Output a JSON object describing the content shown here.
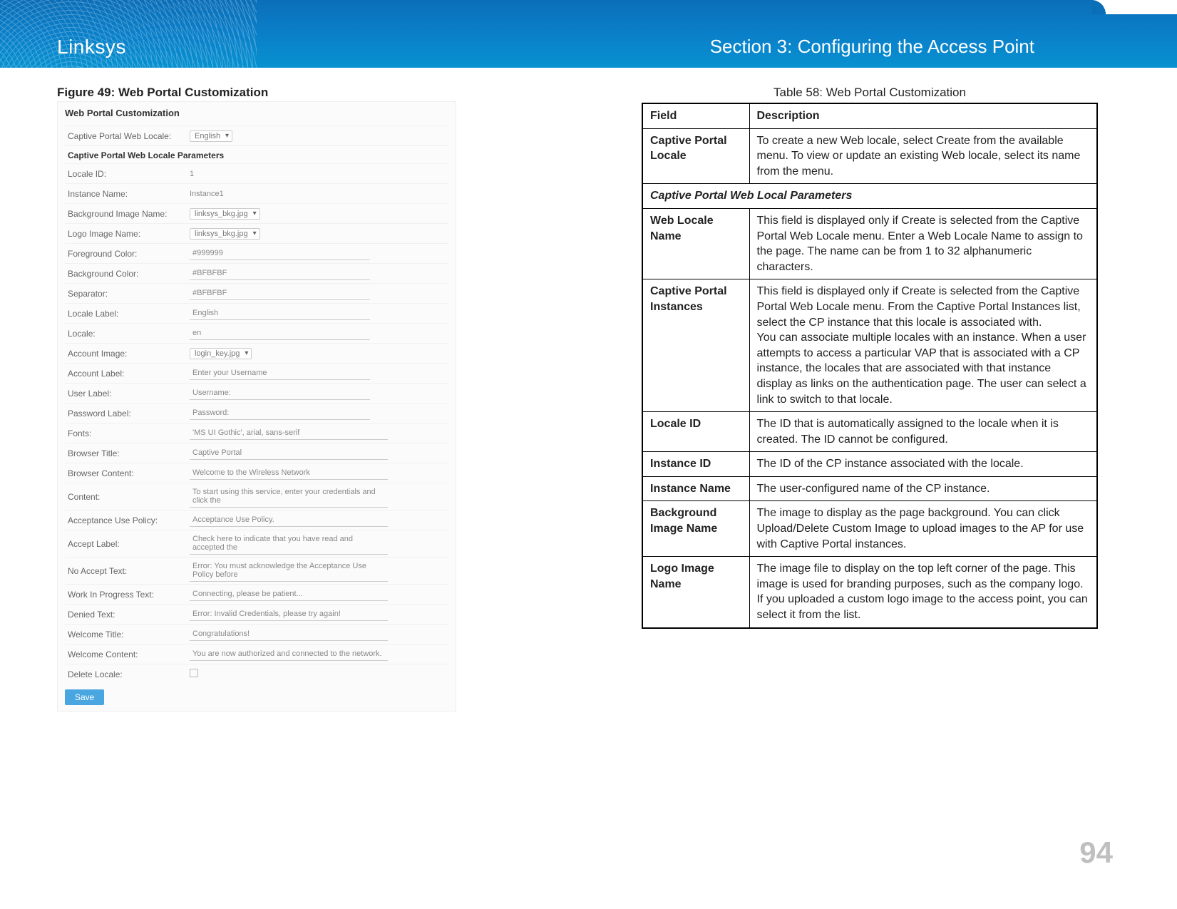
{
  "header": {
    "brand": "Linksys",
    "section": "Section 3:  Configuring the Access Point"
  },
  "figure": {
    "caption": "Figure 49: Web Portal Customization",
    "panel_title": "Web Portal Customization",
    "web_locale_label": "Captive Portal Web Locale:",
    "web_locale_value": "English",
    "params_header": "Captive Portal Web Locale Parameters",
    "rows": {
      "locale_id": {
        "label": "Locale ID:",
        "value": "1"
      },
      "instance_name": {
        "label": "Instance Name:",
        "value": "Instance1"
      },
      "bg_image": {
        "label": "Background Image Name:",
        "value": "linksys_bkg.jpg"
      },
      "logo_image": {
        "label": "Logo Image Name:",
        "value": "linksys_bkg.jpg"
      },
      "fg_color": {
        "label": "Foreground Color:",
        "value": "#999999"
      },
      "bg_color": {
        "label": "Background Color:",
        "value": "#BFBFBF"
      },
      "separator": {
        "label": "Separator:",
        "value": "#BFBFBF"
      },
      "locale_label": {
        "label": "Locale Label:",
        "value": "English"
      },
      "locale": {
        "label": "Locale:",
        "value": "en"
      },
      "account_image": {
        "label": "Account Image:",
        "value": "login_key.jpg"
      },
      "account_label": {
        "label": "Account Label:",
        "value": "Enter your Username"
      },
      "user_label": {
        "label": "User Label:",
        "value": "Username:"
      },
      "password_label": {
        "label": "Password Label:",
        "value": "Password:"
      },
      "fonts": {
        "label": "Fonts:",
        "value": "'MS UI Gothic', arial, sans-serif"
      },
      "browser_title": {
        "label": "Browser Title:",
        "value": "Captive Portal"
      },
      "browser_content": {
        "label": "Browser Content:",
        "value": "Welcome to the Wireless Network"
      },
      "content": {
        "label": "Content:",
        "value": "To start using this service, enter your credentials and click the"
      },
      "acceptance_use": {
        "label": "Acceptance Use Policy:",
        "value": "Acceptance Use Policy."
      },
      "accept_label": {
        "label": "Accept Label:",
        "value": "Check here to indicate that you have read and accepted the"
      },
      "no_accept": {
        "label": "No Accept Text:",
        "value": "Error: You must acknowledge the Acceptance Use Policy before"
      },
      "wip_text": {
        "label": "Work In Progress Text:",
        "value": "Connecting, please be patient..."
      },
      "denied_text": {
        "label": "Denied Text:",
        "value": "Error: Invalid Credentials, please try again!"
      },
      "welcome_title": {
        "label": "Welcome Title:",
        "value": "Congratulations!"
      },
      "welcome_content": {
        "label": "Welcome Content:",
        "value": "You are now authorized and connected to the network."
      },
      "delete_locale": {
        "label": "Delete Locale:",
        "value": ""
      }
    },
    "save_button": "Save"
  },
  "table": {
    "caption": "Table 58: Web Portal Customization",
    "head": {
      "field": "Field",
      "desc": "Description"
    },
    "section_header": "Captive Portal Web Local Parameters",
    "rows": [
      {
        "field": "Captive Portal Locale",
        "desc": "To create a new Web locale, select Create from the available menu. To view or update an existing Web locale, select its name from the menu."
      },
      {
        "field": "Web Locale Name",
        "desc": "This field is displayed only if Create is selected from the Captive Portal Web Locale menu. Enter a Web Locale Name to assign to the page. The name can be from 1 to 32 alphanumeric characters."
      },
      {
        "field": "Captive Portal Instances",
        "desc": "This field is displayed only if Create is selected from the Captive Portal Web Locale menu. From the Captive Portal Instances list, select the CP instance that this locale is associated with.\nYou can associate multiple locales with an instance. When a user attempts to access a particular VAP that is associated with a CP instance, the locales that are associated with that instance display as links on the authentication page. The user can select a link to switch to that locale."
      },
      {
        "field": "Locale ID",
        "desc": "The ID that is automatically assigned to the locale when it is created. The ID cannot be configured."
      },
      {
        "field": "Instance ID",
        "desc": "The ID of the CP instance associated with the locale."
      },
      {
        "field": "Instance Name",
        "desc": "The user-configured name of the CP instance."
      },
      {
        "field": "Background Image Name",
        "desc": "The image to display as the page background. You can click Upload/Delete Custom Image to upload images to the AP for use with Captive Portal instances."
      },
      {
        "field": "Logo Image Name",
        "desc": "The image file to display on the top left corner of the page. This image is used for branding purposes, such as the company logo. If you uploaded a custom logo image to the access point, you can select it from the list."
      }
    ]
  },
  "page_number": "94"
}
